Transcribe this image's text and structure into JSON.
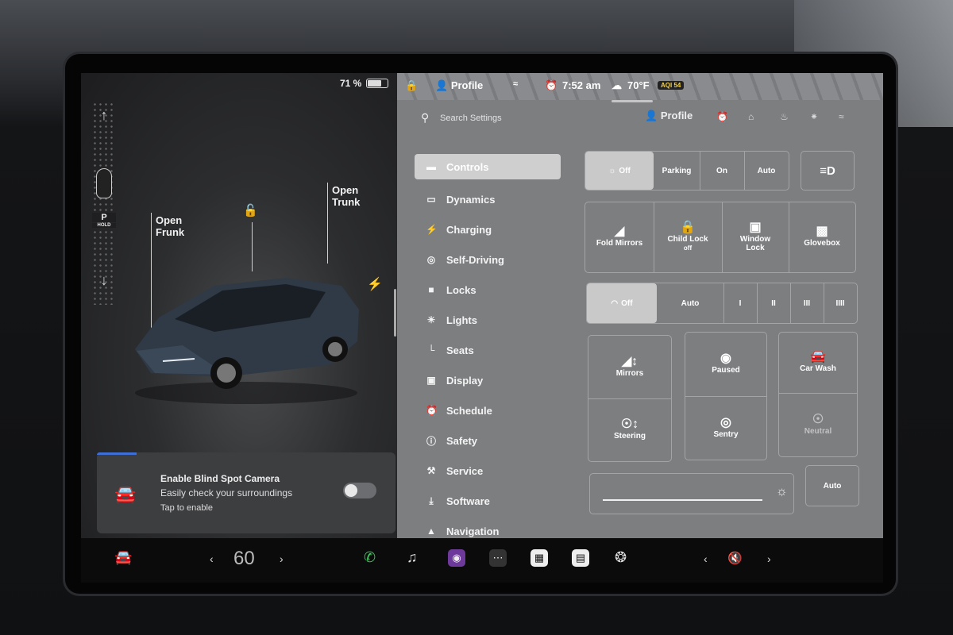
{
  "status": {
    "battery_pct": "71 %",
    "battery_level": 0.71,
    "profile": "Profile",
    "time": "7:52 am",
    "temperature": "70°F",
    "aqi": "AQI 54"
  },
  "car": {
    "gear": "P",
    "gear_hold": "HOLD",
    "open_frunk": "Open\nFrunk",
    "open_trunk": "Open\nTrunk"
  },
  "notice": {
    "title": "Enable Blind Spot Camera",
    "subtitle": "Easily check your surroundings",
    "action": "Tap to enable"
  },
  "search": {
    "placeholder": "Search Settings"
  },
  "header": {
    "profile": "Profile"
  },
  "menu": [
    {
      "label": "Controls",
      "icon": "toggle-icon"
    },
    {
      "label": "Dynamics",
      "icon": "car-icon"
    },
    {
      "label": "Charging",
      "icon": "bolt-icon"
    },
    {
      "label": "Self-Driving",
      "icon": "steering-wheel-icon"
    },
    {
      "label": "Locks",
      "icon": "lock-icon"
    },
    {
      "label": "Lights",
      "icon": "sun-icon"
    },
    {
      "label": "Seats",
      "icon": "seat-icon"
    },
    {
      "label": "Display",
      "icon": "display-icon"
    },
    {
      "label": "Schedule",
      "icon": "alarm-clock-icon"
    },
    {
      "label": "Safety",
      "icon": "alert-icon"
    },
    {
      "label": "Service",
      "icon": "wrench-icon"
    },
    {
      "label": "Software",
      "icon": "download-icon"
    },
    {
      "label": "Navigation",
      "icon": "navigation-icon"
    }
  ],
  "headlights": {
    "off": "Off",
    "parking": "Parking",
    "on": "On",
    "auto": "Auto"
  },
  "quick": {
    "fold_mirrors": "Fold Mirrors",
    "child_lock": "Child Lock",
    "child_lock_state": "off",
    "window_lock": "Window\nLock",
    "glovebox": "Glovebox"
  },
  "wipers": {
    "off": "Off",
    "auto": "Auto",
    "s1": "I",
    "s2": "II",
    "s3": "III",
    "s4": "IIII"
  },
  "adjust": {
    "mirrors": "Mirrors",
    "steering": "Steering",
    "paused": "Paused",
    "sentry": "Sentry",
    "car_wash": "Car Wash",
    "neutral": "Neutral"
  },
  "brightness": {
    "auto": "Auto",
    "level": 0.95
  },
  "dock": {
    "speed": "60"
  }
}
